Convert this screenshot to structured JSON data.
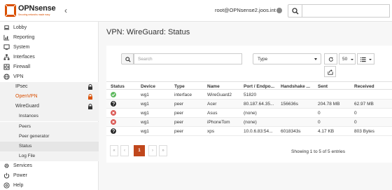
{
  "header": {
    "logo_text": "OPNsense",
    "logo_tagline": "Securing networks made easy",
    "user": "root@OPNsense2.joos.int"
  },
  "sidebar": {
    "items": [
      {
        "label": "Lobby",
        "icon": "laptop-icon"
      },
      {
        "label": "Reporting",
        "icon": "chart-icon"
      },
      {
        "label": "System",
        "icon": "computer-icon"
      },
      {
        "label": "Interfaces",
        "icon": "sitemap-icon"
      },
      {
        "label": "Firewall",
        "icon": "fire-icon"
      },
      {
        "label": "VPN",
        "icon": "globe-icon"
      }
    ],
    "vpn_sub": [
      {
        "label": "IPsec"
      },
      {
        "label": "OpenVPN"
      },
      {
        "label": "WireGuard"
      }
    ],
    "wireguard_sub": [
      {
        "label": "Instances"
      },
      {
        "label": "Peers"
      },
      {
        "label": "Peer generator"
      },
      {
        "label": "Status"
      },
      {
        "label": "Log File"
      }
    ],
    "bottom_items": [
      {
        "label": "Services",
        "icon": "cog-icon"
      },
      {
        "label": "Power",
        "icon": "power-icon"
      },
      {
        "label": "Help",
        "icon": "help-icon"
      }
    ]
  },
  "main": {
    "title": "VPN: WireGuard: Status",
    "search_placeholder": "Search",
    "type_select": "Type",
    "page_size": "50"
  },
  "table": {
    "headers": [
      "Status",
      "Device",
      "Type",
      "Name",
      "Port / Endpo...",
      "Handshake ...",
      "Sent",
      "Received"
    ],
    "rows": [
      {
        "status": "online",
        "device": "wg1",
        "type": "interface",
        "name": "WireGuard2",
        "port": "51820",
        "handshake": "",
        "sent": "",
        "received": ""
      },
      {
        "status": "unknown",
        "device": "wg1",
        "type": "peer",
        "name": "Acer",
        "port": "80.187.64.35...",
        "handshake": "156636s",
        "sent": "204.78 MB",
        "received": "62.97 MB"
      },
      {
        "status": "offline",
        "device": "wg1",
        "type": "peer",
        "name": "Asus",
        "port": "(none)",
        "handshake": "",
        "sent": "0",
        "received": "0"
      },
      {
        "status": "offline",
        "device": "wg1",
        "type": "peer",
        "name": "iPhoneTom",
        "port": "(none)",
        "handshake": "",
        "sent": "0",
        "received": "0"
      },
      {
        "status": "unknown",
        "device": "wg1",
        "type": "peer",
        "name": "xps",
        "port": "10.0.6.83:54...",
        "handshake": "6018343s",
        "sent": "4.17 KB",
        "received": "803 Bytes"
      }
    ]
  },
  "pagination": {
    "first": "«",
    "prev": "‹",
    "current": "1",
    "next": "›",
    "last": "»",
    "info": "Showing 1 to 5 of 5 entries"
  },
  "colors": {
    "accent": "#d94f00",
    "online": "#5cb85c",
    "offline": "#d9534f",
    "unknown": "#222222"
  }
}
